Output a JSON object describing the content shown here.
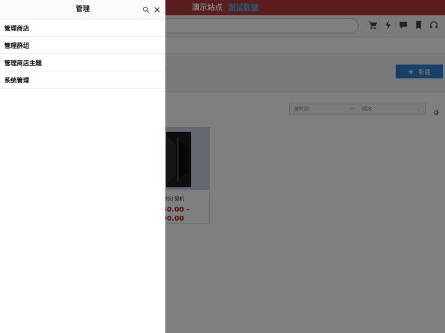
{
  "topbar": {
    "demo_site": "演示站点",
    "test_data": "测试数据"
  },
  "header_icons": [
    "cart-icon",
    "flash-icon",
    "chat-icon",
    "bookmark-icon",
    "headset-icon"
  ],
  "toolbar": {
    "new_label": "新建",
    "new_icon": "plus-icon"
  },
  "filters": {
    "field": "按时间",
    "separator": "~",
    "sort": "顺序",
    "caret": "⌄"
  },
  "product": {
    "name": "的计算机",
    "price_line1": "50.00 -",
    "price_line2": "00.00"
  },
  "drawer": {
    "title": "管理",
    "items": [
      {
        "label": "管理商店"
      },
      {
        "label": "管理群组"
      },
      {
        "label": "管理商店主题"
      },
      {
        "label": "系统管理"
      }
    ]
  },
  "colors": {
    "topbar": "#b73a3a",
    "accent": "#2f7fd0",
    "price": "#b81f1f",
    "overlay": "rgba(0,0,0,0.5)"
  }
}
